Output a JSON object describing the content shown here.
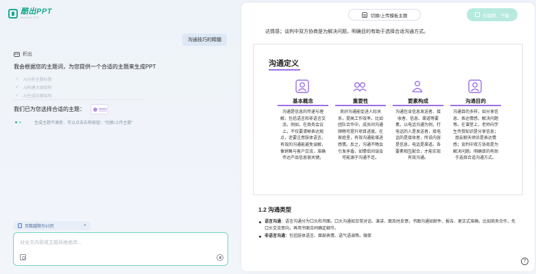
{
  "app": {
    "logo_title": "酷出PPT",
    "logo_subtitle": "KUCHU PPT"
  },
  "chat": {
    "user_message": "沟通技巧的精髓",
    "assistant_name": "积出",
    "assistant_intro": "我会根据您的主题词，为您提供一个合适的主题来生成PPT",
    "steps": [
      {
        "label": "AI分析主题标题"
      },
      {
        "label": "AI构建大纲结构"
      },
      {
        "label": "AI生成页面结构"
      }
    ],
    "theme_chosen_text": "我们已为您选择合适的主题：",
    "loading_text": "生成主题不满意，可以点击右侧按钮：“切换/上传主题”",
    "attachment": {
      "label": "页数越限为10页",
      "close": "×"
    },
    "input": {
      "placeholder": "对全文内容或主题风格修改..."
    }
  },
  "toolbar": {
    "switch_theme_label": "切换/上传模板主题",
    "download_label": "去编辑、下载"
  },
  "document": {
    "top_text": "达情感；谈判中双方协商是为解决问题，明确目的有助于选择合适沟通方式。",
    "slide": {
      "title": "沟通定义",
      "columns": [
        {
          "title": "基本概念",
          "body": "沟通是信息的传递与理解，包括语言和非语言交流。例如，在商务会议上，不仅要清晰表达观点，还要注意肢体语言。有效的沟通能避免误解，像销售与客户交流，准确传达产品信息很关键。"
        },
        {
          "title": "重要性",
          "body": "良好沟通能促进人际关系，提高工作效率。比如团队合作中，成员间沟通顺畅可提升项目进度。在家庭里，有效沟通能增进感情。反之，沟通不畅会引发矛盾，如情侣间误会可能源于沟通不足。"
        },
        {
          "title": "要素构成",
          "body": "沟通包含信息发送者、接收者、信息、渠道等要素。以电话沟通为例，打电话的人是发送者，接电话的是接收者，所说内容是信息，电话是渠道。各要素相互配合，才能实现有效沟通。"
        },
        {
          "title": "沟通目的",
          "body": "沟通目的多样，如分享信息、表达情感、解决问题等。在课堂上，老师向学生传授知识是分享信息；朋友聊天倾诉是表达情感；谈判中双方协商是为解决问题。明确目的有助于选择合适沟通方式。"
        }
      ]
    },
    "section_heading": "1.2 沟通类型",
    "bullets": [
      {
        "term": "语言沟通",
        "text": "：语言沟通分为口头和书面。口头沟通如日常对话、演讲、面及时反馈，书面沟通如邮件、报告、更正式准确。比如商务合作，先口头交流意向，再用书面合同确定细节。"
      },
      {
        "term": "非语言沟通",
        "text": "：包括肢体语言、面部表情、语气语调等。微笑"
      }
    ],
    "help": "?"
  },
  "colors": {
    "accent": "#1aa88f",
    "purple": "#9b6ee8",
    "download_btn": "#b6eadf"
  },
  "icons": [
    "logo-icon",
    "robot-icon",
    "check-icon",
    "document-icon",
    "close-icon",
    "image-icon",
    "send-icon",
    "swap-icon",
    "download-icon",
    "person-icon",
    "people-icon",
    "team-icon",
    "target-icon",
    "help-icon"
  ]
}
